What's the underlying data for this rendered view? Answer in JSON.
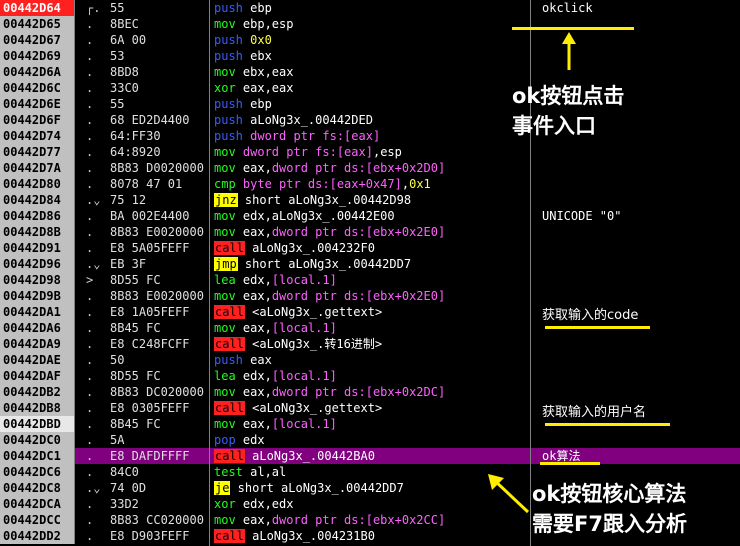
{
  "rows": [
    {
      "addr": "00442D64",
      "mark": "┌.",
      "hex": "55",
      "mn": "push",
      "mc": "blue",
      "ops": [
        {
          "t": " ebp",
          "c": "w"
        }
      ],
      "com": "okclick"
    },
    {
      "addr": "00442D65",
      "mark": ".",
      "hex": "8BEC",
      "mn": "mov",
      "mc": "green",
      "ops": [
        {
          "t": " ebp,esp",
          "c": "w"
        }
      ],
      "com": ""
    },
    {
      "addr": "00442D67",
      "mark": ".",
      "hex": "6A 00",
      "mn": "push",
      "mc": "blue",
      "ops": [
        {
          "t": " 0x0",
          "c": "y"
        }
      ],
      "com": ""
    },
    {
      "addr": "00442D69",
      "mark": ".",
      "hex": "53",
      "mn": "push",
      "mc": "blue",
      "ops": [
        {
          "t": " ebx",
          "c": "w"
        }
      ],
      "com": ""
    },
    {
      "addr": "00442D6A",
      "mark": ".",
      "hex": "8BD8",
      "mn": "mov",
      "mc": "green",
      "ops": [
        {
          "t": " ebx,eax",
          "c": "w"
        }
      ],
      "com": ""
    },
    {
      "addr": "00442D6C",
      "mark": ".",
      "hex": "33C0",
      "mn": "xor",
      "mc": "green",
      "ops": [
        {
          "t": " eax,eax",
          "c": "w"
        }
      ],
      "com": ""
    },
    {
      "addr": "00442D6E",
      "mark": ".",
      "hex": "55",
      "mn": "push",
      "mc": "blue",
      "ops": [
        {
          "t": " ebp",
          "c": "w"
        }
      ],
      "com": ""
    },
    {
      "addr": "00442D6F",
      "mark": ".",
      "hex": "68 ED2D4400",
      "mn": "push",
      "mc": "blue",
      "ops": [
        {
          "t": " aLoNg3x_.00442DED",
          "c": "w"
        }
      ],
      "com": ""
    },
    {
      "addr": "00442D74",
      "mark": ".",
      "hex": "64:FF30",
      "mn": "push",
      "mc": "blue",
      "ops": [
        {
          "t": " dword ptr fs:[eax]",
          "c": "m"
        }
      ],
      "com": ""
    },
    {
      "addr": "00442D77",
      "mark": ".",
      "hex": "64:8920",
      "mn": "mov",
      "mc": "green",
      "ops": [
        {
          "t": " dword ptr fs:[eax]",
          "c": "m"
        },
        {
          "t": ",esp",
          "c": "w"
        }
      ],
      "com": ""
    },
    {
      "addr": "00442D7A",
      "mark": ".",
      "hex": "8B83 D0020000",
      "mn": "mov",
      "mc": "green",
      "ops": [
        {
          "t": " eax,",
          "c": "w"
        },
        {
          "t": "dword ptr ds:[ebx+0x2D0]",
          "c": "m"
        }
      ],
      "com": ""
    },
    {
      "addr": "00442D80",
      "mark": ".",
      "hex": "8078 47 01",
      "mn": "cmp",
      "mc": "green",
      "ops": [
        {
          "t": " byte ptr ds:[eax+0x47]",
          "c": "m"
        },
        {
          "t": ",",
          "c": "w"
        },
        {
          "t": "0x1",
          "c": "y"
        }
      ],
      "com": ""
    },
    {
      "addr": "00442D84",
      "mark": ".⌄",
      "hex": "75 12",
      "mn": "jnz",
      "mc": "hi",
      "ops": [
        {
          "t": " short aLoNg3x_.00442D98",
          "c": "w"
        }
      ],
      "com": ""
    },
    {
      "addr": "00442D86",
      "mark": ".",
      "hex": "BA 002E4400",
      "mn": "mov",
      "mc": "green",
      "ops": [
        {
          "t": " edx,aLoNg3x_.00442E00",
          "c": "w"
        }
      ],
      "com": "UNICODE \"0\""
    },
    {
      "addr": "00442D8B",
      "mark": ".",
      "hex": "8B83 E0020000",
      "mn": "mov",
      "mc": "green",
      "ops": [
        {
          "t": " eax,",
          "c": "w"
        },
        {
          "t": "dword ptr ds:[ebx+0x2E0]",
          "c": "m"
        }
      ],
      "com": ""
    },
    {
      "addr": "00442D91",
      "mark": ".",
      "hex": "E8 5A05FEFF",
      "mn": "call",
      "mc": "call",
      "ops": [
        {
          "t": " aLoNg3x_.004232F0",
          "c": "w"
        }
      ],
      "com": ""
    },
    {
      "addr": "00442D96",
      "mark": ".⌄",
      "hex": "EB 3F",
      "mn": "jmp",
      "mc": "hi",
      "ops": [
        {
          "t": " short aLoNg3x_.00442DD7",
          "c": "w"
        }
      ],
      "com": ""
    },
    {
      "addr": "00442D98",
      "mark": ">",
      "hex": "8D55 FC",
      "mn": "lea",
      "mc": "green",
      "ops": [
        {
          "t": " edx,",
          "c": "w"
        },
        {
          "t": "[local.1]",
          "c": "m"
        }
      ],
      "com": ""
    },
    {
      "addr": "00442D9B",
      "mark": ".",
      "hex": "8B83 E0020000",
      "mn": "mov",
      "mc": "green",
      "ops": [
        {
          "t": " eax,",
          "c": "w"
        },
        {
          "t": "dword ptr ds:[ebx+0x2E0]",
          "c": "m"
        }
      ],
      "com": ""
    },
    {
      "addr": "00442DA1",
      "mark": ".",
      "hex": "E8 1A05FEFF",
      "mn": "call",
      "mc": "call",
      "ops": [
        {
          "t": " <aLoNg3x_.gettext>",
          "c": "w"
        }
      ],
      "com": ""
    },
    {
      "addr": "00442DA6",
      "mark": ".",
      "hex": "8B45 FC",
      "mn": "mov",
      "mc": "green",
      "ops": [
        {
          "t": " eax,",
          "c": "w"
        },
        {
          "t": "[local.1]",
          "c": "m"
        }
      ],
      "com": ""
    },
    {
      "addr": "00442DA9",
      "mark": ".",
      "hex": "E8 C248FCFF",
      "mn": "call",
      "mc": "call",
      "ops": [
        {
          "t": " <aLoNg3x_.转16进制>",
          "c": "w"
        }
      ],
      "com": ""
    },
    {
      "addr": "00442DAE",
      "mark": ".",
      "hex": "50",
      "mn": "push",
      "mc": "blue",
      "ops": [
        {
          "t": " eax",
          "c": "w"
        }
      ],
      "com": ""
    },
    {
      "addr": "00442DAF",
      "mark": ".",
      "hex": "8D55 FC",
      "mn": "lea",
      "mc": "green",
      "ops": [
        {
          "t": " edx,",
          "c": "w"
        },
        {
          "t": "[local.1]",
          "c": "m"
        }
      ],
      "com": ""
    },
    {
      "addr": "00442DB2",
      "mark": ".",
      "hex": "8B83 DC020000",
      "mn": "mov",
      "mc": "green",
      "ops": [
        {
          "t": " eax,",
          "c": "w"
        },
        {
          "t": "dword ptr ds:[ebx+0x2DC]",
          "c": "m"
        }
      ],
      "com": ""
    },
    {
      "addr": "00442DB8",
      "mark": ".",
      "hex": "E8 0305FEFF",
      "mn": "call",
      "mc": "call",
      "ops": [
        {
          "t": " <aLoNg3x_.gettext>",
          "c": "w"
        }
      ],
      "com": ""
    },
    {
      "addr": "00442DBD",
      "mark": ".",
      "hex": "8B45 FC",
      "mn": "mov",
      "mc": "green",
      "ops": [
        {
          "t": " eax,",
          "c": "w"
        },
        {
          "t": "[local.1]",
          "c": "m"
        }
      ],
      "com": "",
      "cur": true
    },
    {
      "addr": "00442DC0",
      "mark": ".",
      "hex": "5A",
      "mn": "pop",
      "mc": "blue",
      "ops": [
        {
          "t": " edx",
          "c": "w"
        }
      ],
      "com": ""
    },
    {
      "addr": "00442DC1",
      "mark": ".",
      "hex": "E8 DAFDFFFF",
      "mn": "call",
      "mc": "call",
      "ops": [
        {
          "t": " aLoNg3x_.00442BA0",
          "c": "w"
        }
      ],
      "com": "ok算法",
      "sel": true
    },
    {
      "addr": "00442DC6",
      "mark": ".",
      "hex": "84C0",
      "mn": "test",
      "mc": "green",
      "ops": [
        {
          "t": " al,al",
          "c": "w"
        }
      ],
      "com": ""
    },
    {
      "addr": "00442DC8",
      "mark": ".⌄",
      "hex": "74 0D",
      "mn": "je",
      "mc": "hi",
      "ops": [
        {
          "t": " short aLoNg3x_.00442DD7",
          "c": "w"
        }
      ],
      "com": ""
    },
    {
      "addr": "00442DCA",
      "mark": ".",
      "hex": "33D2",
      "mn": "xor",
      "mc": "green",
      "ops": [
        {
          "t": " edx,edx",
          "c": "w"
        }
      ],
      "com": ""
    },
    {
      "addr": "00442DCC",
      "mark": ".",
      "hex": "8B83 CC020000",
      "mn": "mov",
      "mc": "green",
      "ops": [
        {
          "t": " eax,",
          "c": "w"
        },
        {
          "t": "dword ptr ds:[ebx+0x2CC]",
          "c": "m"
        }
      ],
      "com": ""
    },
    {
      "addr": "00442DD2",
      "mark": ".",
      "hex": "E8 D903FEFF",
      "mn": "call",
      "mc": "call",
      "ops": [
        {
          "t": " aLoNg3x_.004231B0",
          "c": "w"
        }
      ],
      "com": ""
    }
  ],
  "annotations": {
    "entry_line1": "ok按钮点击",
    "entry_line2": "事件入口",
    "get_code": "获取输入的code",
    "get_user": "获取输入的用户名",
    "core_line1": "ok按钮核心算法",
    "core_line2": "需要F7跟入分析"
  },
  "colors": {
    "annot_yellow": "#ffee00",
    "selected_row": "#800080",
    "address_bg": "#c0c0c0"
  }
}
